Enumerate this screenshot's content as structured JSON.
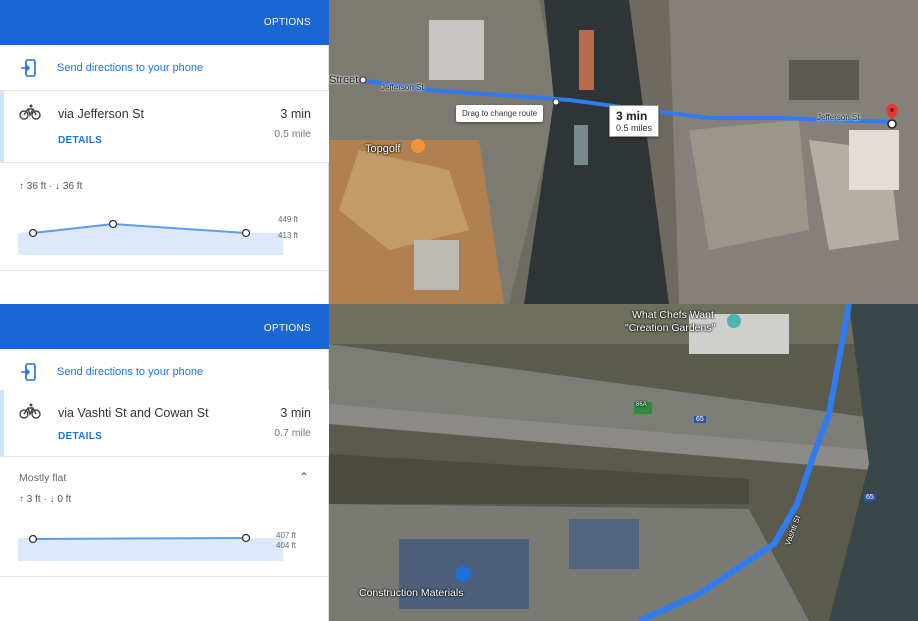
{
  "panel1": {
    "options_label": "OPTIONS",
    "send_label": "Send directions to your phone",
    "route": {
      "via": "via Jefferson St",
      "time": "3 min",
      "distance": "0.5 mile",
      "details": "DETAILS"
    },
    "elevation": {
      "gain_loss": "↑ 36 ft · ↓ 36 ft",
      "max_label": "449 ft",
      "min_label": "413 ft"
    },
    "map": {
      "street_label": "Street",
      "road_label_1": "Jefferson St",
      "road_label_2": "Jefferson St",
      "drag_tip": "Drag to change route",
      "route_time": "3 min",
      "route_distance": "0.5 miles",
      "poi": "Topgolf"
    }
  },
  "panel2": {
    "options_label": "OPTIONS",
    "send_label": "Send directions to your phone",
    "route": {
      "via": "via Vashti St and Cowan St",
      "time": "3 min",
      "distance": "0.7 mile",
      "details": "DETAILS"
    },
    "elevation": {
      "summary": "Mostly flat",
      "gain_loss": "↑ 3 ft · ↓ 0 ft",
      "max_label": "407 ft",
      "min_label": "404 ft"
    },
    "map": {
      "poi_1_line1": "What Chefs Want",
      "poi_1_line2": "\"Creation Gardens\"",
      "poi_2": "Construction Materials",
      "road_label": "Vashti St",
      "shield_1": "86A",
      "shield_2": "65",
      "shield_3": "65"
    }
  },
  "colors": {
    "accent": "#1a66d2",
    "route": "#2f7bf0",
    "link": "#1a73e8"
  }
}
